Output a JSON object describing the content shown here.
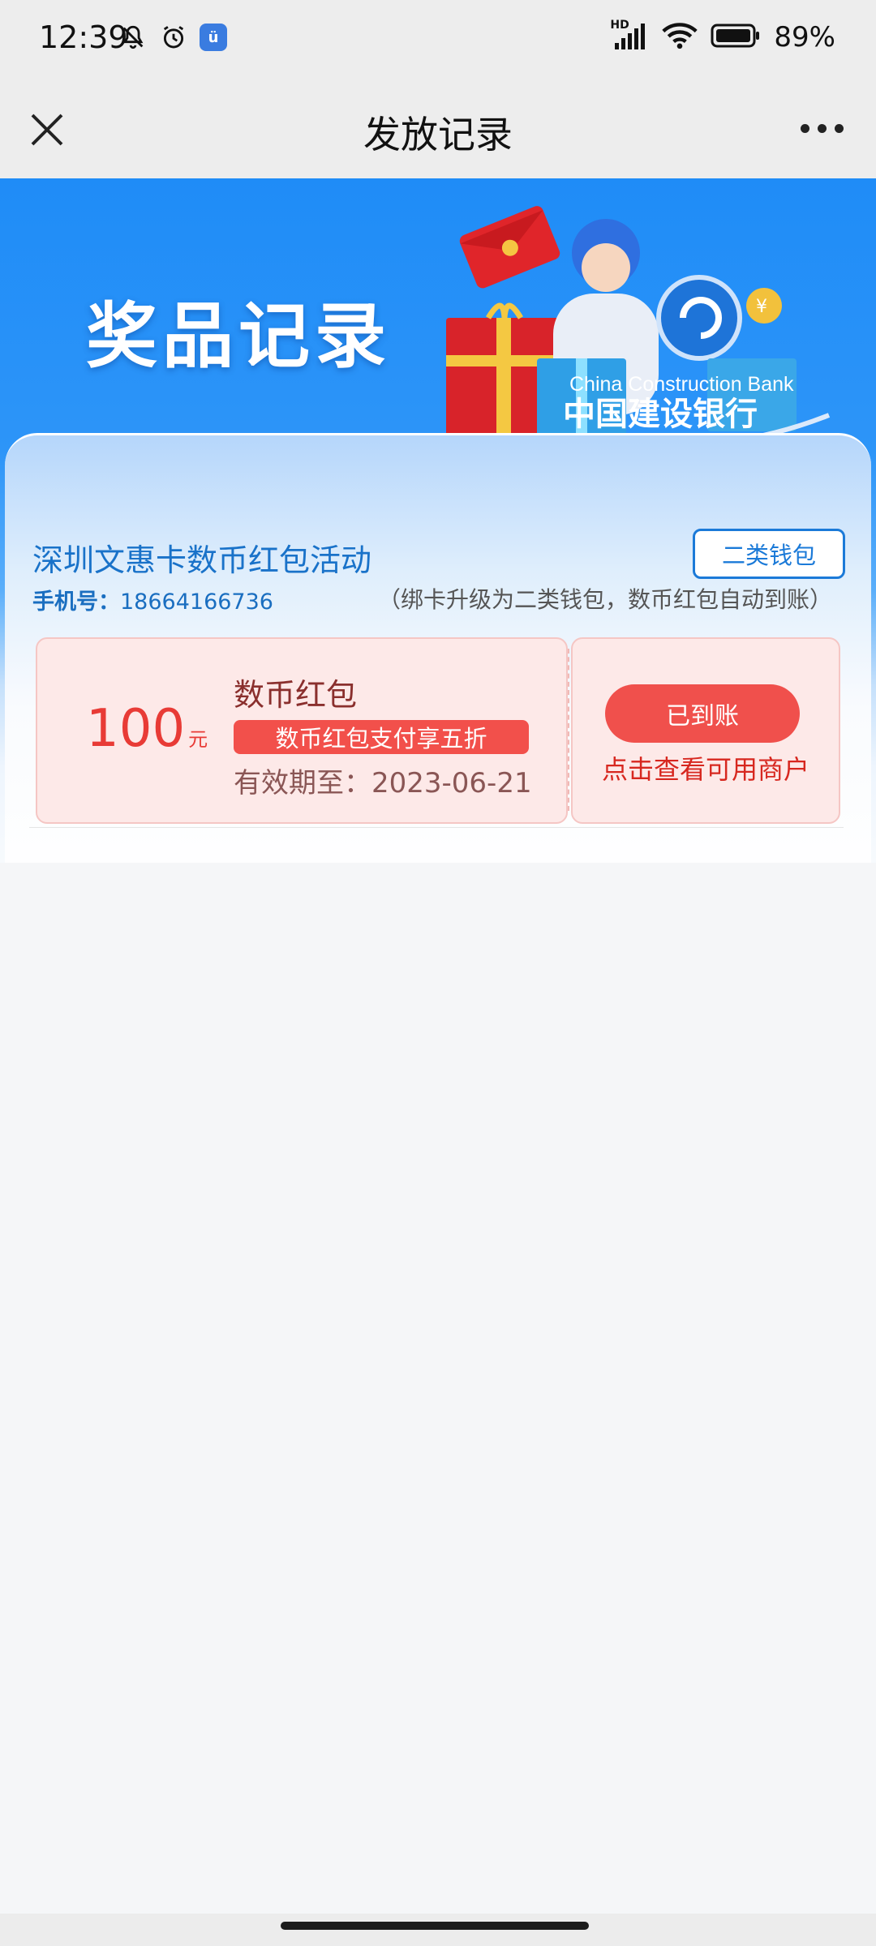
{
  "status_bar": {
    "time": "12:39",
    "network_label": "HD",
    "battery_percent": "89%",
    "icons": [
      "bell-off-icon",
      "alarm-icon",
      "app-icon",
      "signal-icon",
      "wifi-icon",
      "battery-icon"
    ],
    "app_icon_glyph": "ü"
  },
  "nav": {
    "title": "发放记录",
    "close_icon": "close-icon",
    "more_icon": "more-icon"
  },
  "banner": {
    "title": "奖品记录",
    "bank_name_en": "China Construction Bank",
    "bank_name_cn": "中国建设银行"
  },
  "activity": {
    "title": "深圳文惠卡数币红包活动",
    "wallet_button": "二类钱包",
    "phone_label": "手机号：",
    "phone_number": "18664166736",
    "note": "（绑卡升级为二类钱包，数币红包自动到账）"
  },
  "coupon": {
    "amount": "100",
    "unit": "元",
    "name": "数币红包",
    "tag": "数币红包支付享五折",
    "expiry": "有效期至：2023-06-21",
    "status_button": "已到账",
    "merchant_link": "点击查看可用商户"
  },
  "colors": {
    "brand_blue": "#1f8cf7",
    "accent_red": "#f0504c",
    "coupon_bg": "#fde9e8"
  }
}
